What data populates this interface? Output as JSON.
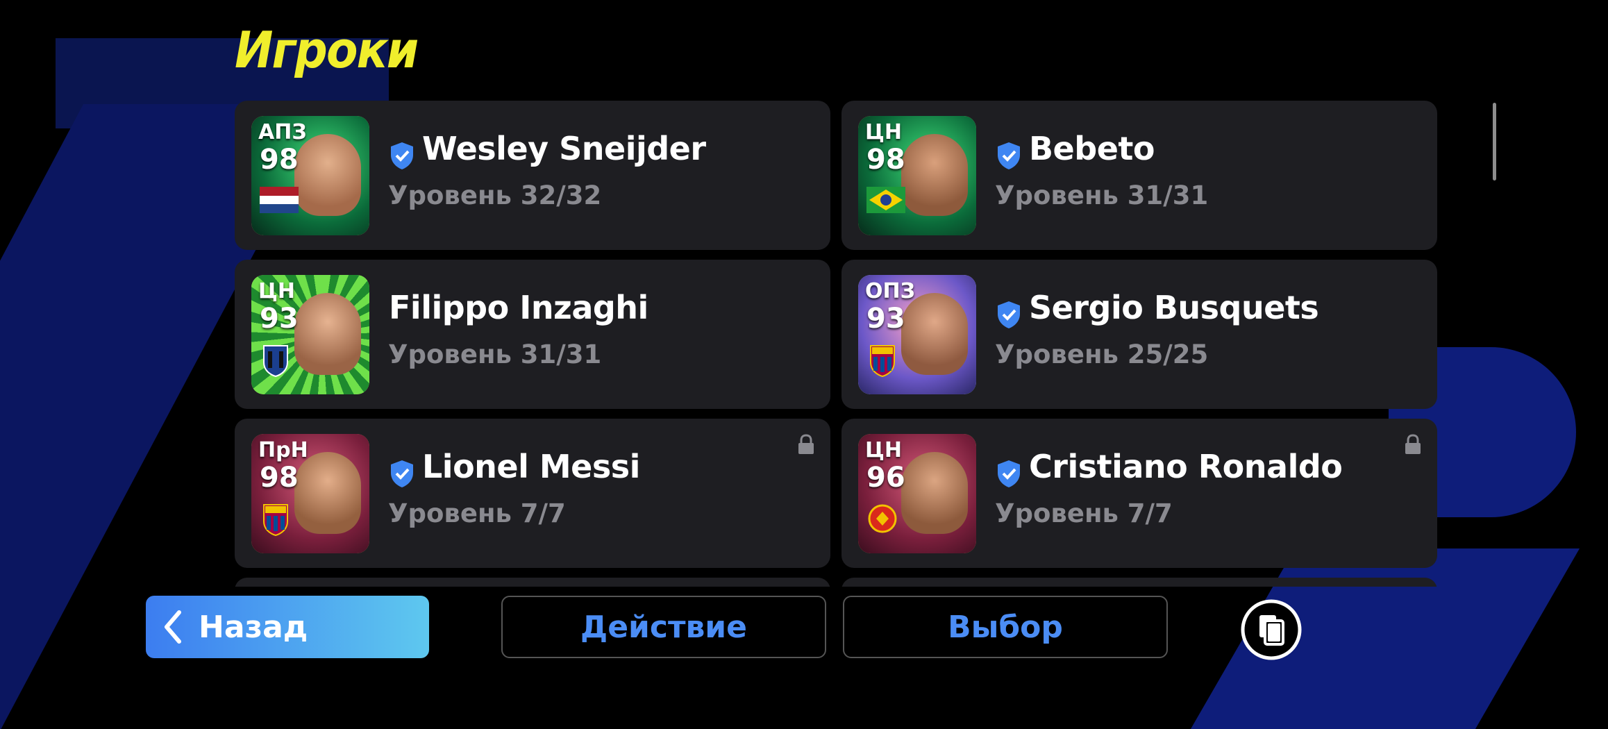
{
  "title": "Игроки",
  "players": [
    {
      "position": "АПЗ",
      "rating": "98",
      "name": "Wesley Sneijder",
      "level": "Уровень 32/32",
      "verified": true,
      "locked": false,
      "flag": "netherlands"
    },
    {
      "position": "ЦН",
      "rating": "98",
      "name": "Bebeto",
      "level": "Уровень 31/31",
      "verified": true,
      "locked": false,
      "flag": "brazil"
    },
    {
      "position": "ЦН",
      "rating": "93",
      "name": "Filippo Inzaghi",
      "level": "Уровень 31/31",
      "verified": false,
      "locked": false,
      "flag": "atalanta"
    },
    {
      "position": "ОПЗ",
      "rating": "93",
      "name": "Sergio Busquets",
      "level": "Уровень 25/25",
      "verified": true,
      "locked": false,
      "flag": "barcelona"
    },
    {
      "position": "ПрН",
      "rating": "98",
      "name": "Lionel Messi",
      "level": "Уровень 7/7",
      "verified": true,
      "locked": true,
      "flag": "barcelona"
    },
    {
      "position": "ЦН",
      "rating": "96",
      "name": "Cristiano Ronaldo",
      "level": "Уровень 7/7",
      "verified": true,
      "locked": true,
      "flag": "manutd"
    }
  ],
  "buttons": {
    "back": "Назад",
    "action": "Действие",
    "select": "Выбор"
  },
  "icons": {
    "back": "chevron-left-icon",
    "verified": "shield-check-icon",
    "lock": "lock-icon",
    "toggle": "copy-cards-icon"
  }
}
